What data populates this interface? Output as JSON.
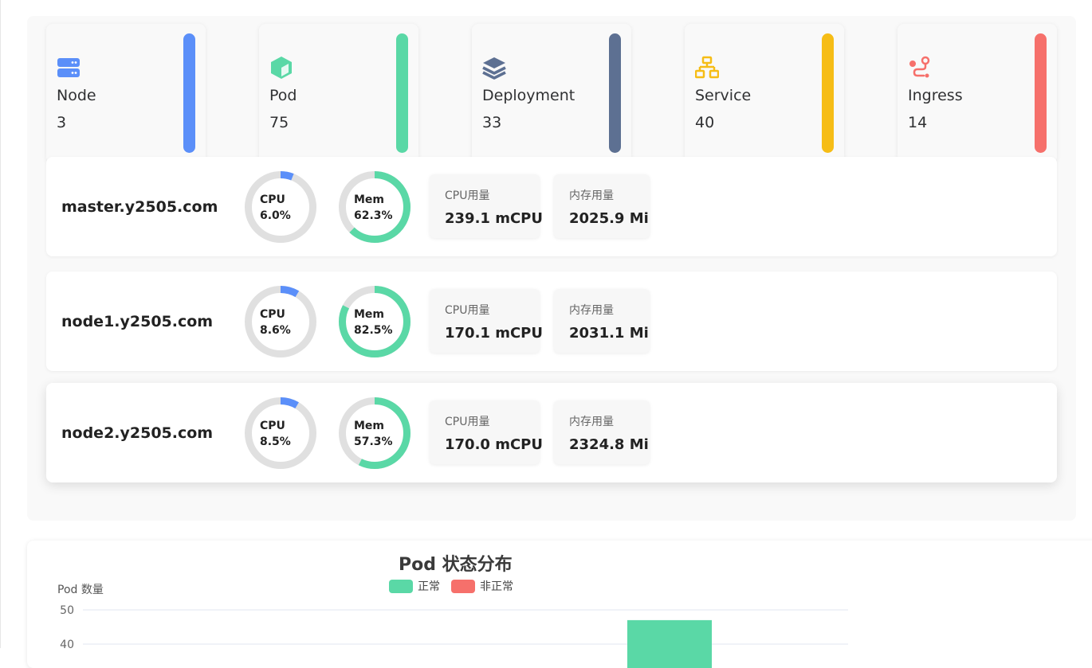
{
  "stats": [
    {
      "label": "Node",
      "value": "3",
      "color": "#5b8ff9",
      "icon": "server-icon"
    },
    {
      "label": "Pod",
      "value": "75",
      "color": "#5ad8a6",
      "icon": "cube-icon"
    },
    {
      "label": "Deployment",
      "value": "33",
      "color": "#5d7092",
      "icon": "layers-icon"
    },
    {
      "label": "Service",
      "value": "40",
      "color": "#f6bd16",
      "icon": "network-icon"
    },
    {
      "label": "Ingress",
      "value": "14",
      "color": "#f6706b",
      "icon": "route-icon"
    }
  ],
  "nodes": [
    {
      "name": "master.y2505.com",
      "cpu_label": "CPU",
      "cpu_pct": "6.0%",
      "cpu_val": 6.0,
      "mem_label": "Mem",
      "mem_pct": "62.3%",
      "mem_val": 62.3,
      "cpu_usage_label": "CPU用量",
      "cpu_usage": "239.1 mCPU",
      "mem_usage_label": "内存用量",
      "mem_usage": "2025.9 Mi"
    },
    {
      "name": "node1.y2505.com",
      "cpu_label": "CPU",
      "cpu_pct": "8.6%",
      "cpu_val": 8.6,
      "mem_label": "Mem",
      "mem_pct": "82.5%",
      "mem_val": 82.5,
      "cpu_usage_label": "CPU用量",
      "cpu_usage": "170.1 mCPU",
      "mem_usage_label": "内存用量",
      "mem_usage": "2031.1 Mi"
    },
    {
      "name": "node2.y2505.com",
      "cpu_label": "CPU",
      "cpu_pct": "8.5%",
      "cpu_val": 8.5,
      "mem_label": "Mem",
      "mem_pct": "57.3%",
      "mem_val": 57.3,
      "cpu_usage_label": "CPU用量",
      "cpu_usage": "170.0 mCPU",
      "mem_usage_label": "内存用量",
      "mem_usage": "2324.8 Mi"
    }
  ],
  "colors": {
    "cpu": "#5b8ff9",
    "mem": "#5ad8a6",
    "track": "#e0e0e0"
  },
  "chart_data": {
    "type": "bar",
    "title": "Pod 状态分布",
    "ylabel": "Pod 数量",
    "xlabel": "",
    "legend": [
      "正常",
      "非正常"
    ],
    "legend_colors": [
      "#5ad8a6",
      "#f6706b"
    ],
    "yticks": [
      50,
      40
    ],
    "ylim": [
      0,
      50
    ],
    "series": [
      {
        "name": "正常",
        "values": [
          47
        ]
      }
    ]
  }
}
